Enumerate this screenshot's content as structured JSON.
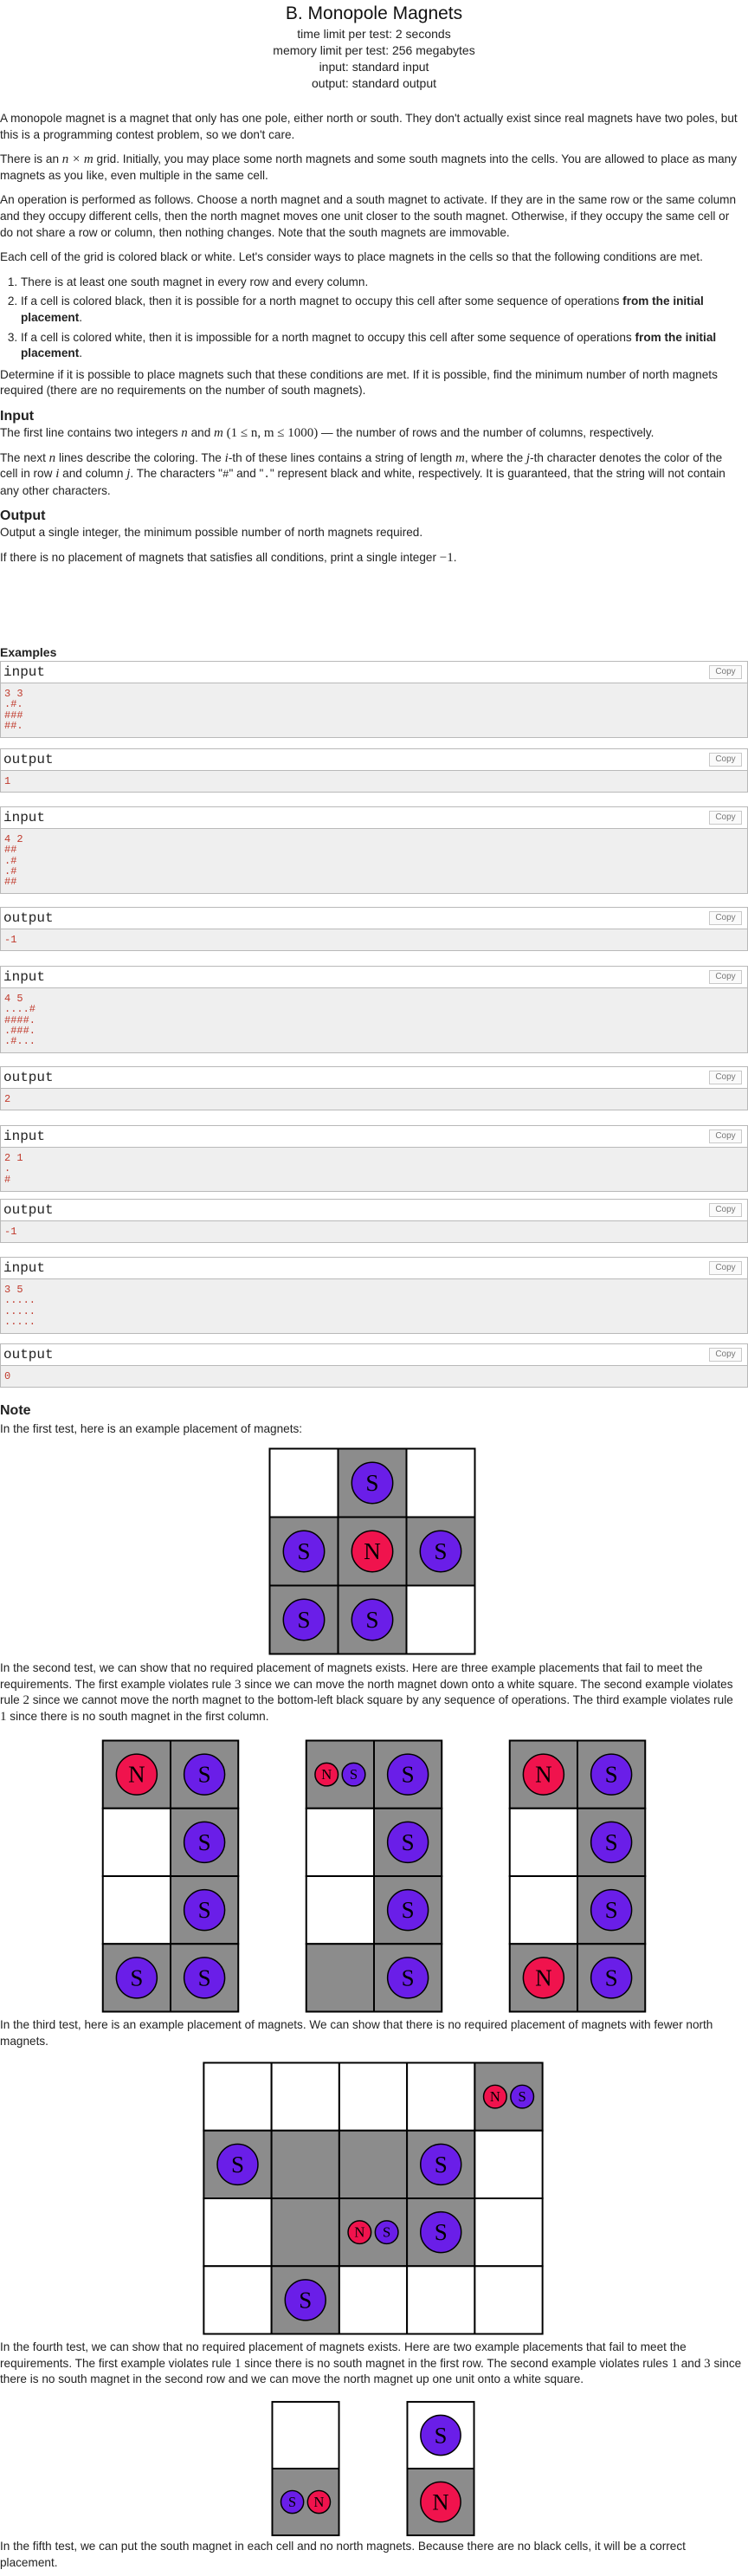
{
  "header": {
    "title": "B. Monopole Magnets",
    "time_limit": "time limit per test: 2 seconds",
    "memory_limit": "memory limit per test: 256 megabytes",
    "input": "input: standard input",
    "output": "output: standard output"
  },
  "statement": {
    "p1": "A monopole magnet is a magnet that only has one pole, either north or south. They don't actually exist since real magnets have two poles, but this is a programming contest problem, so we don't care.",
    "p2a": "There is an ",
    "p2_math": "n × m",
    "p2b": " grid. Initially, you may place some north magnets and some south magnets into the cells. You are allowed to place as many magnets as you like, even multiple in the same cell.",
    "p3": "An operation is performed as follows. Choose a north magnet and a south magnet to activate. If they are in the same row or the same column and they occupy different cells, then the north magnet moves one unit closer to the south magnet. Otherwise, if they occupy the same cell or do not share a row or column, then nothing changes. Note that the south magnets are immovable.",
    "p4": "Each cell of the grid is colored black or white. Let's consider ways to place magnets in the cells so that the following conditions are met.",
    "rules": [
      {
        "text": "There is at least one south magnet in every row and every column.",
        "bold": ""
      },
      {
        "text": "If a cell is colored black, then it is possible for a north magnet to occupy this cell after some sequence of operations ",
        "bold": "from the initial placement",
        "end": "."
      },
      {
        "text": "If a cell is colored white, then it is impossible for a north magnet to occupy this cell after some sequence of operations ",
        "bold": "from the initial placement",
        "end": "."
      }
    ],
    "p5": "Determine if it is possible to place magnets such that these conditions are met. If it is possible, find the minimum number of north magnets required (there are no requirements on the number of south magnets).",
    "input_title": "Input",
    "input_p1a": "The first line contains two integers ",
    "input_p1_n": "n",
    "input_p1_and": " and ",
    "input_p1_m": "m",
    "input_p1_range": "(1 ≤ n, m ≤ 1000)",
    "input_p1b": " — the number of rows and the number of columns, respectively.",
    "input_p2a": "The next ",
    "input_p2_n": "n",
    "input_p2b": " lines describe the coloring. The ",
    "input_p2_i": "i",
    "input_p2c": "-th of these lines contains a string of length ",
    "input_p2_m": "m",
    "input_p2d": ", where the ",
    "input_p2_j": "j",
    "input_p2e": "-th character denotes the color of the cell in row ",
    "input_p2_i2": "i",
    "input_p2f": " and column ",
    "input_p2_j2": "j",
    "input_p2g": ". The characters \"",
    "input_p2_hash": "#",
    "input_p2h": "\" and \"",
    "input_p2_dot": ".",
    "input_p2i": "\" represent black and white, respectively. It is guaranteed, that the string will not contain any other characters.",
    "output_title": "Output",
    "output_p1": "Output a single integer, the minimum possible number of north magnets required.",
    "output_p2a": "If there is no placement of magnets that satisfies all conditions, print a single integer ",
    "output_p2_val": "−1",
    "output_p2b": "."
  },
  "examples_title": "Examples",
  "input_label": "input",
  "output_label": "output",
  "copy_label": "Copy",
  "examples": [
    {
      "input": "3 3\n.#.\n###\n##.",
      "output": "1"
    },
    {
      "input": "4 2\n##\n.#\n.#\n##",
      "output": "-1"
    },
    {
      "input": "4 5\n....#\n####.\n.###.\n.#...",
      "output": "2"
    },
    {
      "input": "2 1\n.\n#",
      "output": "-1"
    },
    {
      "input": "3 5\n.....\n.....\n.....",
      "output": "0"
    }
  ],
  "note": {
    "title": "Note",
    "n1": "In the first test, here is an example placement of magnets:",
    "n2a": "In the second test, we can show that no required placement of magnets exists. Here are three example placements that fail to meet the requirements. The first example violates rule ",
    "n2_r1": "3",
    "n2b": " since we can move the north magnet down onto a white square. The second example violates rule ",
    "n2_r2": "2",
    "n2c": " since we cannot move the north magnet to the bottom-left black square by any sequence of operations. The third example violates rule ",
    "n2_r3": "1",
    "n2d": " since there is no south magnet in the first column.",
    "n3": "In the third test, here is an example placement of magnets. We can show that there is no required placement of magnets with fewer north magnets.",
    "n4a": "In the fourth test, we can show that no required placement of magnets exists. Here are two example placements that fail to meet the requirements. The first example violates rule ",
    "n4_r1": "1",
    "n4b": " since there is no south magnet in the first row. The second example violates rules ",
    "n4_r2": "1",
    "n4_and": " and ",
    "n4_r3": "3",
    "n4c": " since there is no south magnet in the second row and we can move the north magnet up one unit onto a white square.",
    "n5": "In the fifth test, we can put the south magnet in each cell and no north magnets. Because there are no black cells, it will be a correct placement."
  },
  "magnet_labels": {
    "north": "N",
    "south": "S"
  },
  "colors": {
    "black_cell": "#8c8c8c",
    "white_cell": "#ffffff",
    "north": "#f0134d",
    "south": "#6a1ee8",
    "border": "#000000"
  },
  "figures": [
    {
      "grid": [
        ".#.",
        "###",
        "##."
      ],
      "magnets": [
        [
          [],
          [
            "S"
          ],
          []
        ],
        [
          [
            "S"
          ],
          [
            "N"
          ],
          [
            "S"
          ]
        ],
        [
          [
            "S"
          ],
          [
            "S"
          ],
          []
        ]
      ]
    },
    {
      "grid": [
        "##",
        ".#",
        ".#",
        "##"
      ],
      "magnets": [
        [
          [
            "N"
          ],
          [
            "S"
          ]
        ],
        [
          [],
          [
            "S"
          ]
        ],
        [
          [],
          [
            "S"
          ]
        ],
        [
          [
            "S"
          ],
          [
            "S"
          ]
        ]
      ]
    },
    {
      "grid": [
        "##",
        ".#",
        ".#",
        "##"
      ],
      "magnets": [
        [
          [
            "N",
            "S"
          ],
          [
            "S"
          ]
        ],
        [
          [],
          [
            "S"
          ]
        ],
        [
          [],
          [
            "S"
          ]
        ],
        [
          [],
          [
            "S"
          ]
        ]
      ]
    },
    {
      "grid": [
        "##",
        ".#",
        ".#",
        "##"
      ],
      "magnets": [
        [
          [
            "N"
          ],
          [
            "S"
          ]
        ],
        [
          [],
          [
            "S"
          ]
        ],
        [
          [],
          [
            "S"
          ]
        ],
        [
          [
            "N"
          ],
          [
            "S"
          ]
        ]
      ]
    },
    {
      "grid": [
        "....#",
        "####.",
        ".###.",
        ".#..."
      ],
      "magnets": [
        [
          [],
          [],
          [],
          [],
          [
            "N",
            "S"
          ]
        ],
        [
          [
            "S"
          ],
          [],
          [],
          [
            "S"
          ],
          []
        ],
        [
          [],
          [],
          [
            "N",
            "S"
          ],
          [
            "S"
          ],
          []
        ],
        [
          [],
          [
            "S"
          ],
          [],
          [],
          []
        ]
      ]
    },
    {
      "grid": [
        ".",
        "#"
      ],
      "magnets": [
        [
          []
        ],
        [
          [
            "S",
            "N"
          ]
        ]
      ]
    },
    {
      "grid": [
        ".",
        "#"
      ],
      "magnets": [
        [
          [
            "S"
          ]
        ],
        [
          [
            "N"
          ]
        ]
      ]
    }
  ]
}
